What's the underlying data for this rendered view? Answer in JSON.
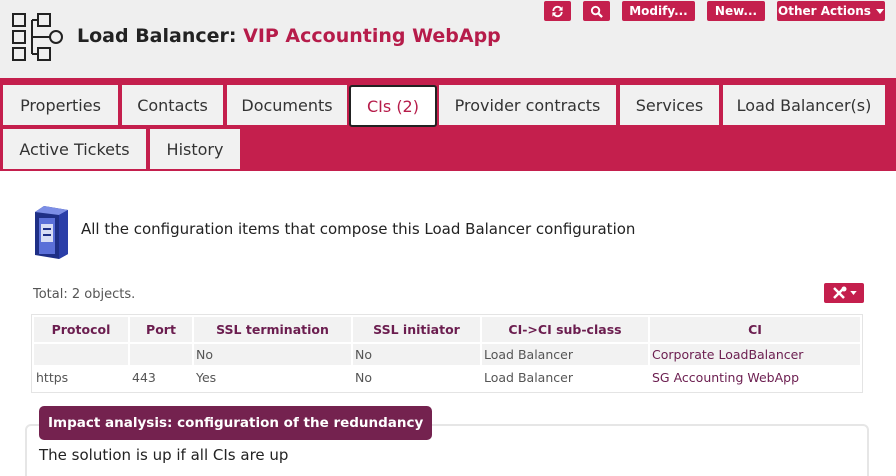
{
  "header": {
    "object_class": "Load Balancer:",
    "object_name": "VIP Accounting WebApp",
    "icon": "load-balancer-icon"
  },
  "toolbar": {
    "refresh_icon": "refresh-icon",
    "search_icon": "search-icon",
    "modify_label": "Modify...",
    "new_label": "New...",
    "other_actions_label": "Other Actions",
    "accent_color": "#c41f4d"
  },
  "tabs": [
    {
      "label": "Properties"
    },
    {
      "label": "Contacts"
    },
    {
      "label": "Documents"
    },
    {
      "label": "CIs (2)",
      "active": true
    },
    {
      "label": "Provider contracts"
    },
    {
      "label": "Services"
    },
    {
      "label": "Load Balancer(s)"
    },
    {
      "label": "Active Tickets"
    },
    {
      "label": "History"
    }
  ],
  "main": {
    "description": "All the configuration items that compose this Load Balancer configuration",
    "total": "Total: 2 objects.",
    "tools_icon": "tools-icon"
  },
  "table": {
    "columns": [
      "Protocol",
      "Port",
      "SSL termination",
      "SSL initiator",
      "CI->CI sub-class",
      "CI"
    ],
    "rows": [
      [
        "",
        "",
        "No",
        "No",
        "Load Balancer",
        "Corporate LoadBalancer"
      ],
      [
        "https",
        "443",
        "Yes",
        "No",
        "Load Balancer",
        "SG Accounting WebApp"
      ]
    ]
  },
  "impact": {
    "legend": "Impact analysis: configuration of the redundancy",
    "text": "The solution is up if all CIs are up"
  }
}
